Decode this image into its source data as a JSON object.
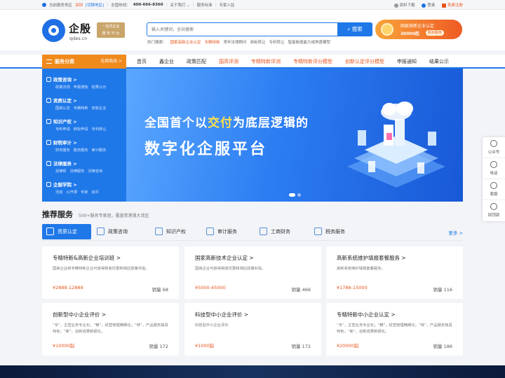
{
  "topbar": {
    "region_label": "当前服务地区",
    "city": "深圳",
    "switch": "[切换地区]",
    "hotline_label": "全国热线：",
    "hotline": "400-666-8360",
    "about": "关于我们",
    "standard": "服务标准",
    "join": "专家入驻",
    "download": "资料下载",
    "login": "登录",
    "register": "免费注册"
  },
  "header": {
    "brand": "企殷",
    "domain": "qdes.cn",
    "slogan_line1": "一站式企业",
    "slogan_line2": "服 务 平 台",
    "search_placeholder": "输入关键词，全站搜索",
    "search_button": "搜索",
    "hot_label": "热门搜索：",
    "hot_words": [
      "国家高新企业认定",
      "专精特新",
      "常年法律顾问",
      "商标转让",
      "专利转让",
      "智能制造能力成熟度模型"
    ],
    "promo_line1": "国家高新企业认定",
    "promo_price": "30000起",
    "promo_buy": "购买服务"
  },
  "nav": {
    "category_label": "服务分类",
    "all_label": "全部商品 >",
    "items": [
      "首页",
      "鑫企业",
      "政策匹配",
      "国高评测",
      "专精特新评测",
      "专精特新评分模型",
      "创新认定评分模型",
      "申报通知",
      "结果公示"
    ]
  },
  "sidebar": [
    {
      "title": "政策咨询 >",
      "subs": [
        "政策法规",
        "申报通知",
        "结果公示"
      ]
    },
    {
      "title": "资质认定 >",
      "subs": [
        "国高认定",
        "专精特新",
        "双软企业"
      ]
    },
    {
      "title": "知识产权 >",
      "subs": [
        "专利申请",
        "商标申请",
        "专利转让"
      ]
    },
    {
      "title": "财税审计 >",
      "subs": [
        "财务服务",
        "税务服务",
        "审计服务"
      ]
    },
    {
      "title": "法律服务 >",
      "subs": [
        "找律师",
        "法律服务",
        "法律咨询"
      ]
    },
    {
      "title": "企服学院 >",
      "subs": [
        "活动",
        "公开课",
        "专家",
        "会问"
      ]
    }
  ],
  "banner": {
    "line1_pre": "全国首个以",
    "line1_hl": "交付",
    "line1_post": "为底层逻辑的",
    "line2": "数字化企服平台"
  },
  "float": {
    "items": [
      "公众号",
      "电话",
      "客服",
      "回顶部"
    ]
  },
  "services": {
    "title": "推荐服务",
    "subtitle": "500+服务专家团，覆盖粤港澳大湾区",
    "more": "更多 >",
    "tabs": [
      "资质认定",
      "政策咨询",
      "知识产权",
      "审计服务",
      "工商财务",
      "税务服务"
    ],
    "cards": [
      {
        "title": "专精特新&高新企业培训班 >",
        "desc": "国高企业和专精特新企业可获得税收优惠和相应政策补贴。",
        "price": "¥2888-12888",
        "sales": "销量 68"
      },
      {
        "title": "国家高新技术企业认定 >",
        "desc": "国高企业可获得税收优惠和相应政策补贴。",
        "price": "¥5000-45000",
        "sales": "销量 466"
      },
      {
        "title": "高新系统维护填报套餐服务 >",
        "desc": "高新系统维护填报套餐服务。",
        "price": "¥1788-15000",
        "sales": "销量 116"
      },
      {
        "title": "创新型中小企业评价 >",
        "desc": "“专”，主营业务专业化；“精”，经营管理精细化；“特”，产品服务独具特色；“新”，创新成果新颖化。",
        "price": "¥10000起",
        "sales": "销量 172"
      },
      {
        "title": "科技型中小企业评价 >",
        "desc": "科技型中小企业评价",
        "price": "¥1000起",
        "sales": "销量 172"
      },
      {
        "title": "专精特新中小企业认定 >",
        "desc": "“专”，主营业务专业化；“精”，经营管理精细化；“特”，产品服务独具特色；“新”，创新成果新颖化。",
        "price": "¥20000起",
        "sales": "销量 186"
      }
    ]
  }
}
